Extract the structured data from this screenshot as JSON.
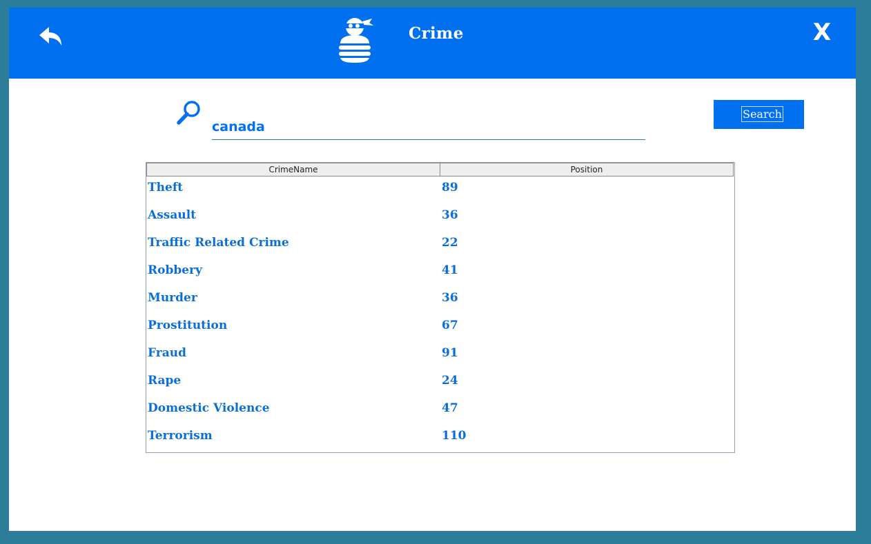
{
  "colors": {
    "frame": "#2b7d99",
    "header": "#0070f0",
    "text_accent": "#0a6ed9"
  },
  "header": {
    "title": "Crime",
    "back_icon": "back-arrow-icon",
    "mascot_icon": "burglar-icon",
    "close_label": "X"
  },
  "search": {
    "icon": "search-icon",
    "value": "canada",
    "button_label": "Search"
  },
  "table": {
    "columns": [
      "CrimeName",
      "Position"
    ],
    "rows": [
      {
        "name": "Theft",
        "position": "89"
      },
      {
        "name": "Assault",
        "position": "36"
      },
      {
        "name": "Traffic Related Crime",
        "position": "22"
      },
      {
        "name": "Robbery",
        "position": "41"
      },
      {
        "name": "Murder",
        "position": "36"
      },
      {
        "name": "Prostitution",
        "position": "67"
      },
      {
        "name": "Fraud",
        "position": "91"
      },
      {
        "name": "Rape",
        "position": "24"
      },
      {
        "name": "Domestic Violence",
        "position": "47"
      },
      {
        "name": "Terrorism",
        "position": "110"
      }
    ]
  }
}
